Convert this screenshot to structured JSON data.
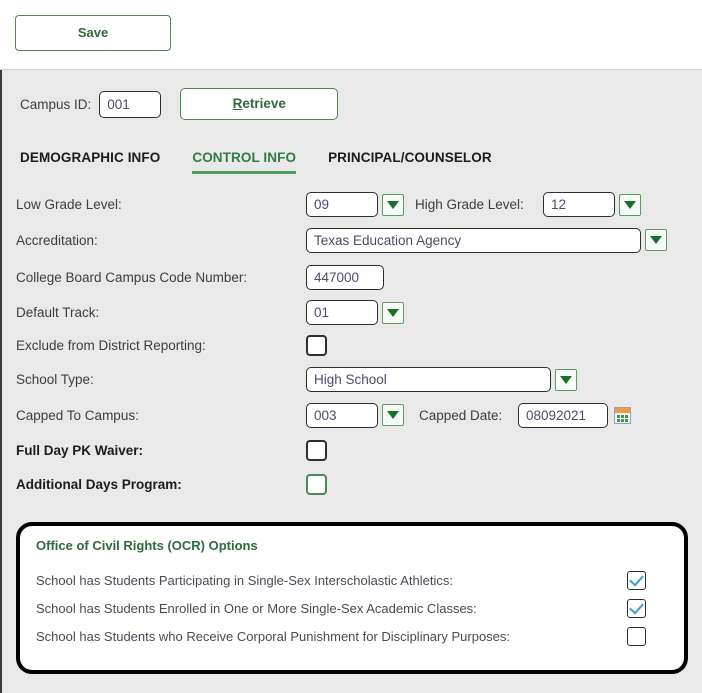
{
  "toolbar": {
    "save_label": "Save"
  },
  "campus": {
    "label": "Campus ID:",
    "value": "001",
    "retrieve_accel": "R",
    "retrieve_rest": "etrieve"
  },
  "tabs": [
    {
      "label": "DEMOGRAPHIC INFO",
      "active": false
    },
    {
      "label": "CONTROL INFO",
      "active": true
    },
    {
      "label": "PRINCIPAL/COUNSELOR",
      "active": false
    }
  ],
  "fields": {
    "low_grade_label": "Low Grade Level:",
    "low_grade_value": "09",
    "high_grade_label": "High Grade Level:",
    "high_grade_value": "12",
    "accreditation_label": "Accreditation:",
    "accreditation_value": "Texas Education Agency",
    "college_board_label": "College Board Campus Code Number:",
    "college_board_value": "447000",
    "default_track_label": "Default Track:",
    "default_track_value": "01",
    "exclude_label": "Exclude from District Reporting:",
    "school_type_label": "School Type:",
    "school_type_value": "High School",
    "capped_campus_label": "Capped To Campus:",
    "capped_campus_value": "003",
    "capped_date_label": "Capped Date:",
    "capped_date_value": "08092021",
    "full_day_pk_label": "Full Day PK Waiver:",
    "additional_days_label": "Additional Days Program:"
  },
  "ocr": {
    "title": "Office of Civil Rights (OCR) Options",
    "rows": [
      {
        "label": "School has Students Participating in Single-Sex Interscholastic Athletics:",
        "checked": true
      },
      {
        "label": "School has Students Enrolled in One or More Single-Sex Academic Classes:",
        "checked": true
      },
      {
        "label": "School has Students who Receive Corporal Punishment for Disciplinary Purposes:",
        "checked": false
      }
    ]
  },
  "colors": {
    "accent_green": "#2f7d42",
    "border_green": "#4b8b52",
    "panel_gray": "#e9e9e9",
    "check_blue": "#3aa0c8",
    "calendar_orange": "#f09a3e"
  }
}
